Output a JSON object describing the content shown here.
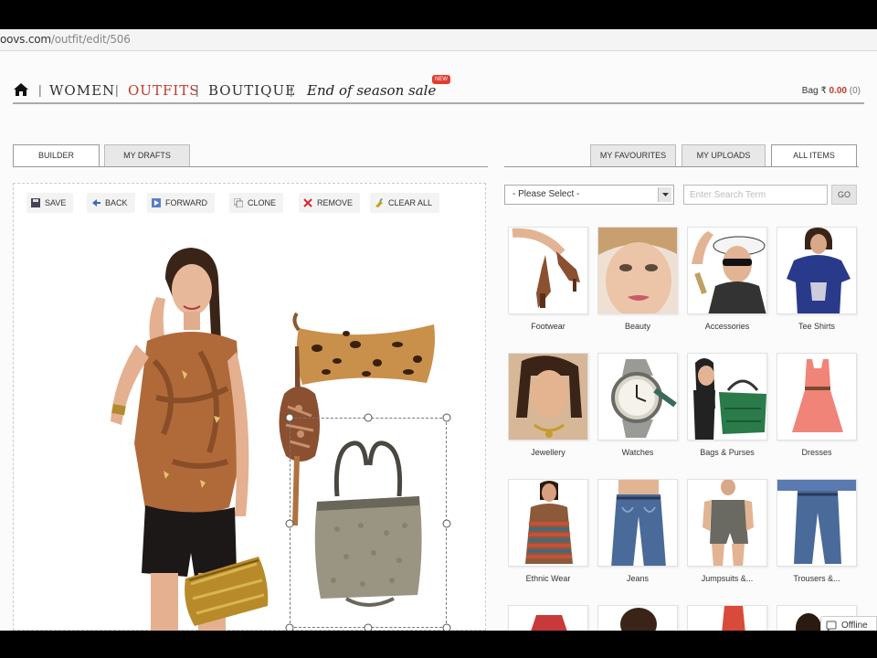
{
  "browser": {
    "url_host": "oovs.com",
    "url_path": "/outfit/edit/506"
  },
  "nav": {
    "women": "WOMEN",
    "outfits": "OUTFITS",
    "boutique": "BOUTIQUE",
    "sep": "|",
    "sale": "End of season sale",
    "new_badge": "NEW",
    "bag_label": "Bag ₹",
    "bag_amount": "0.00",
    "bag_count": "(0)"
  },
  "tabs": {
    "builder": "BUILDER",
    "drafts": "MY DRAFTS",
    "favourites": "MY FAVOURITES",
    "uploads": "MY UPLOADS",
    "all_items": "ALL ITEMS"
  },
  "toolbar": {
    "save": "SAVE",
    "back": "BACK",
    "forward": "FORWARD",
    "clone": "CLONE",
    "remove": "REMOVE",
    "clear_all": "CLEAR ALL"
  },
  "filter": {
    "select_value": "- Please Select -",
    "search_placeholder": "Enter Search Term",
    "go": "GO"
  },
  "categories": [
    {
      "label": "Footwear",
      "icon": "heels-icon"
    },
    {
      "label": "Beauty",
      "icon": "face-icon"
    },
    {
      "label": "Accessories",
      "icon": "hat-icon"
    },
    {
      "label": "Tee Shirts",
      "icon": "tshirt-icon"
    },
    {
      "label": "Jewellery",
      "icon": "jewel-icon"
    },
    {
      "label": "Watches",
      "icon": "watch-icon"
    },
    {
      "label": "Bags & Purses",
      "icon": "bag-icon"
    },
    {
      "label": "Dresses",
      "icon": "dress-icon"
    },
    {
      "label": "Ethnic Wear",
      "icon": "kurti-icon"
    },
    {
      "label": "Jeans",
      "icon": "jeans-icon"
    },
    {
      "label": "Jumpsuits &...",
      "icon": "jumpsuit-icon"
    },
    {
      "label": "Trousers &...",
      "icon": "trousers-icon"
    }
  ],
  "status": {
    "offline": "Offline"
  },
  "colors": {
    "accent": "#c0392b",
    "badge": "#e23c2f"
  }
}
